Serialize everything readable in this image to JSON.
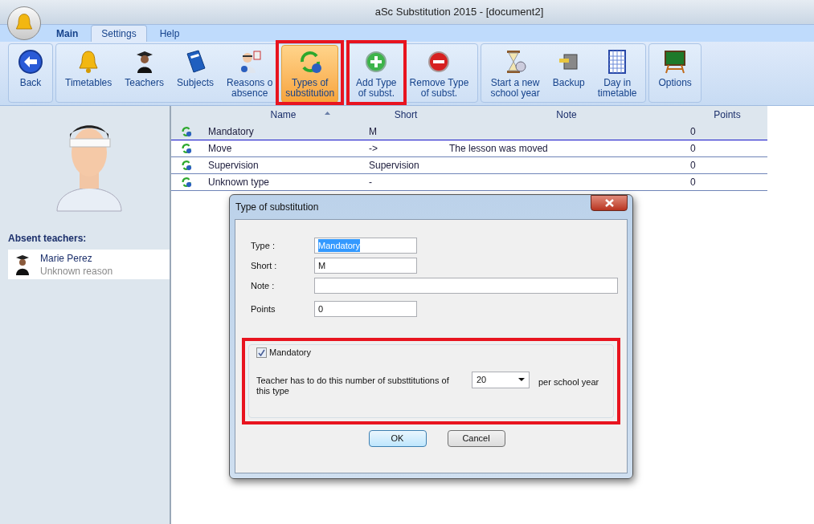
{
  "window": {
    "title": "aSc Substitution 2015  - [document2]"
  },
  "menu_tabs": [
    {
      "label": "Main",
      "kind": "app",
      "selected": false
    },
    {
      "label": "Settings",
      "kind": "tab",
      "selected": true
    },
    {
      "label": "Help",
      "kind": "tab",
      "selected": false
    }
  ],
  "ribbon": {
    "groups": [
      {
        "buttons": [
          {
            "lines": [
              "Back"
            ],
            "kind": "back",
            "selected": false,
            "annotated": false
          }
        ]
      },
      {
        "buttons": [
          {
            "lines": [
              "Timetables"
            ],
            "kind": "bell",
            "selected": false,
            "annotated": false
          },
          {
            "lines": [
              "Teachers"
            ],
            "kind": "teacher",
            "selected": false,
            "annotated": false
          },
          {
            "lines": [
              "Subjects"
            ],
            "kind": "book",
            "selected": false,
            "annotated": false
          },
          {
            "lines": [
              "Reasons o",
              "absence"
            ],
            "kind": "doctor",
            "selected": false,
            "annotated": false
          },
          {
            "lines": [
              "Types of",
              "substitution"
            ],
            "kind": "cycle",
            "selected": true,
            "annotated": true
          }
        ]
      },
      {
        "buttons": [
          {
            "lines": [
              "Add Type",
              "of subst."
            ],
            "kind": "add",
            "selected": false,
            "annotated": true
          },
          {
            "lines": [
              "Remove Type",
              "of subst."
            ],
            "kind": "remove",
            "selected": false,
            "annotated": false
          }
        ]
      },
      {
        "buttons": [
          {
            "lines": [
              "Start a new",
              "school year"
            ],
            "kind": "hourglass",
            "selected": false,
            "annotated": false
          },
          {
            "lines": [
              "Backup"
            ],
            "kind": "backup",
            "selected": false,
            "annotated": false
          },
          {
            "lines": [
              "Day in",
              "timetable"
            ],
            "kind": "grid",
            "selected": false,
            "annotated": false
          }
        ]
      },
      {
        "buttons": [
          {
            "lines": [
              "Options"
            ],
            "kind": "board",
            "selected": false,
            "annotated": false
          }
        ]
      }
    ]
  },
  "sidebar": {
    "heading": "Absent teachers:",
    "teachers": [
      {
        "name": "Marie Perez",
        "reason": "Unknown reason"
      }
    ]
  },
  "table": {
    "columns": [
      {
        "label": "Name",
        "sorted": true
      },
      {
        "label": "Short",
        "sorted": false
      },
      {
        "label": "Note",
        "sorted": false
      },
      {
        "label": "Points",
        "sorted": false
      }
    ],
    "rows": [
      {
        "name": "Mandatory",
        "short": "M",
        "points": "0",
        "selected": true
      },
      {
        "name": "Move",
        "short": "->",
        "note": "The lesson was moved",
        "points": "0",
        "selected": false
      },
      {
        "name": "Supervision",
        "short": "Supervision",
        "points": "0",
        "selected": false
      },
      {
        "name": "Unknown type",
        "short": "-",
        "points": "0",
        "selected": false
      }
    ]
  },
  "dialog": {
    "title": "Type of substitution",
    "fields": [
      {
        "label": "Type :",
        "value": "Mandatory",
        "kind": "short",
        "text_selected": true
      },
      {
        "label": "Short :",
        "value": "M",
        "kind": "short",
        "text_selected": false
      },
      {
        "label": "Note :",
        "kind": "long"
      },
      {
        "label": "Points",
        "value": "0",
        "kind": "short",
        "text_selected": false
      }
    ],
    "group": {
      "annotated": true,
      "checkbox": {
        "label": "Mandatory",
        "checked": true
      },
      "text": "Teacher has to do this number of substtitutions of this type",
      "dropdown": {
        "value": "20"
      },
      "suffix": "per school year"
    },
    "buttons": [
      {
        "label": "OK",
        "default": true
      },
      {
        "label": "Cancel",
        "default": false
      }
    ]
  }
}
